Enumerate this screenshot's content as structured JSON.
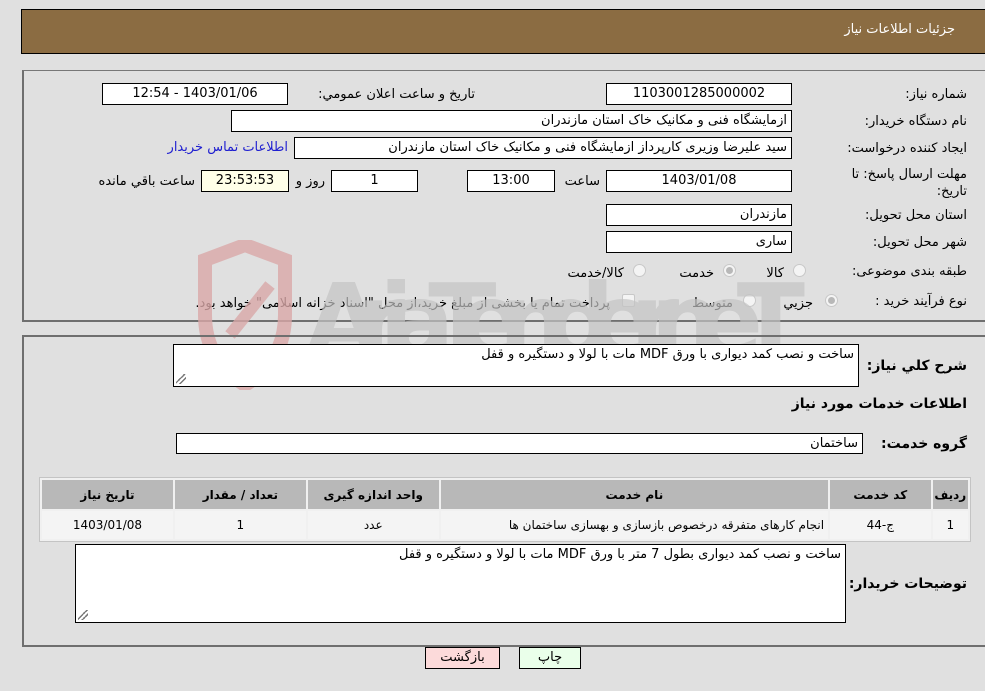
{
  "header": {
    "title": "جزئیات اطلاعات نیاز"
  },
  "fields": {
    "need_number_label": "شماره نیاز:",
    "need_number": "1103001285000002",
    "announce_label": "تاریخ و ساعت اعلان عمومي:",
    "announce_value": "1403/01/06 - 12:54",
    "buyer_org_label": "نام دستگاه خریدار:",
    "buyer_org": "ازمایشگاه فنی و مکانیک خاک استان مازندران",
    "requester_label": "ایجاد کننده درخواست:",
    "requester": "سید علیرضا  وزیری  کارپرداز ازمایشگاه فنی و مکانیک خاک استان مازندران",
    "buyer_contact_link": "اطلاعات تماس خریدار",
    "deadline_label_line1": "مهلت ارسال پاسخ: تا",
    "deadline_label_line2": "تاریخ:",
    "deadline_date": "1403/01/08",
    "time_label": "ساعت",
    "deadline_time": "13:00",
    "days_value": "1",
    "days_label": "روز و",
    "remaining_time": "23:53:53",
    "remaining_label": "ساعت باقي مانده",
    "province_label": "استان محل تحویل:",
    "province": "مازندران",
    "city_label": "شهر محل تحویل:",
    "city": "ساری",
    "category_label": "طبقه بندی موضوعی:",
    "category_options": [
      {
        "label": "کالا",
        "checked": false
      },
      {
        "label": "خدمت",
        "checked": true
      },
      {
        "label": "کالا/خدمت",
        "checked": false
      }
    ],
    "process_label": "نوع فرآیند خرید :",
    "process_options": [
      {
        "label": "جزیي",
        "checked": true
      },
      {
        "label": "متوسط",
        "checked": false
      }
    ],
    "treasury_checkbox_label": "پرداخت تمام یا بخشی از مبلغ خرید،از محل \"اسناد خزانه اسلامی\" خواهد بود.",
    "treasury_checked": false
  },
  "details": {
    "summary_label": "شرح كلي نياز:",
    "summary": "ساخت و نصب کمد دیواری با ورق MDF مات با لولا و دستگیره و قفل",
    "services_heading": "اطلاعات خدمات مورد نیاز",
    "service_group_label": "گروه خدمت:",
    "service_group": "ساختمان",
    "table": {
      "headers": [
        "ردیف",
        "کد خدمت",
        "نام خدمت",
        "واحد اندازه گیری",
        "تعداد / مقدار",
        "تاریخ نیاز"
      ],
      "rows": [
        [
          "1",
          "ج-44",
          "انجام کارهای متفرقه درخصوص بازسازی و بهسازی ساختمان ها",
          "عدد",
          "1",
          "1403/01/08"
        ]
      ]
    },
    "buyer_notes_label": "توضیحات خریدار:",
    "buyer_notes": "ساخت و نصب کمد دیواری بطول 7 متر با ورق MDF مات با لولا و دستگیره و قفل"
  },
  "buttons": {
    "print": "چاپ",
    "back": "بازگشت"
  },
  "watermark": {
    "text": "AriaTender.neT"
  }
}
